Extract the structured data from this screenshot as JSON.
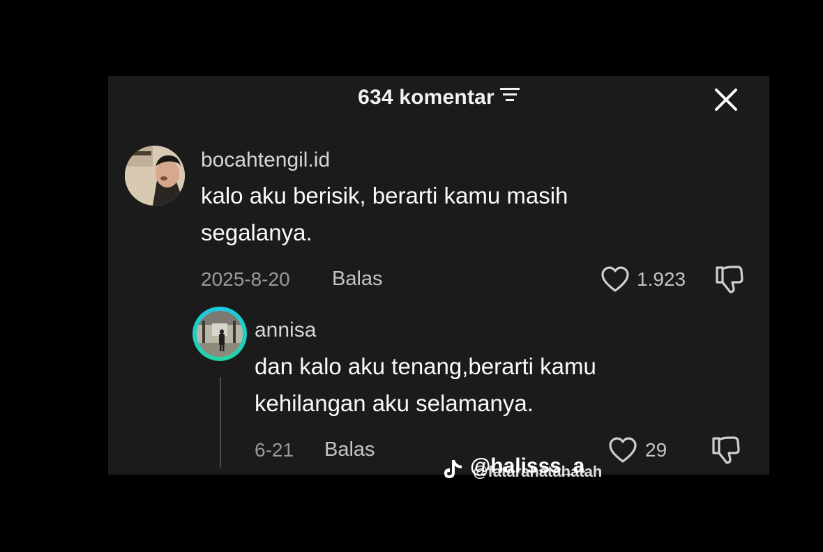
{
  "header": {
    "title": "634 komentar"
  },
  "comments": [
    {
      "username": "bocahtengil.id",
      "text_line1": "kalo aku berisik, berarti kamu masih",
      "text_line2": "segalanya.",
      "date": "2025-8-20",
      "reply_label": "Balas",
      "likes": "1.923"
    }
  ],
  "replies": [
    {
      "username": "annisa",
      "text_line1": "dan kalo aku tenang,berarti kamu",
      "text_line2": "kehilangan aku selamanya.",
      "date": "6-21",
      "reply_label": "Balas",
      "likes": "29"
    }
  ],
  "watermark": {
    "text": "@halisss_a",
    "overlay_text": "@fatarahatahatah"
  },
  "colors": {
    "panel_bg": "#1b1b1b",
    "ring_accent": "#1ec8e6"
  },
  "icons": [
    "filter-icon",
    "close-icon",
    "heart-icon",
    "dislike-icon",
    "tiktok-logo-icon"
  ]
}
